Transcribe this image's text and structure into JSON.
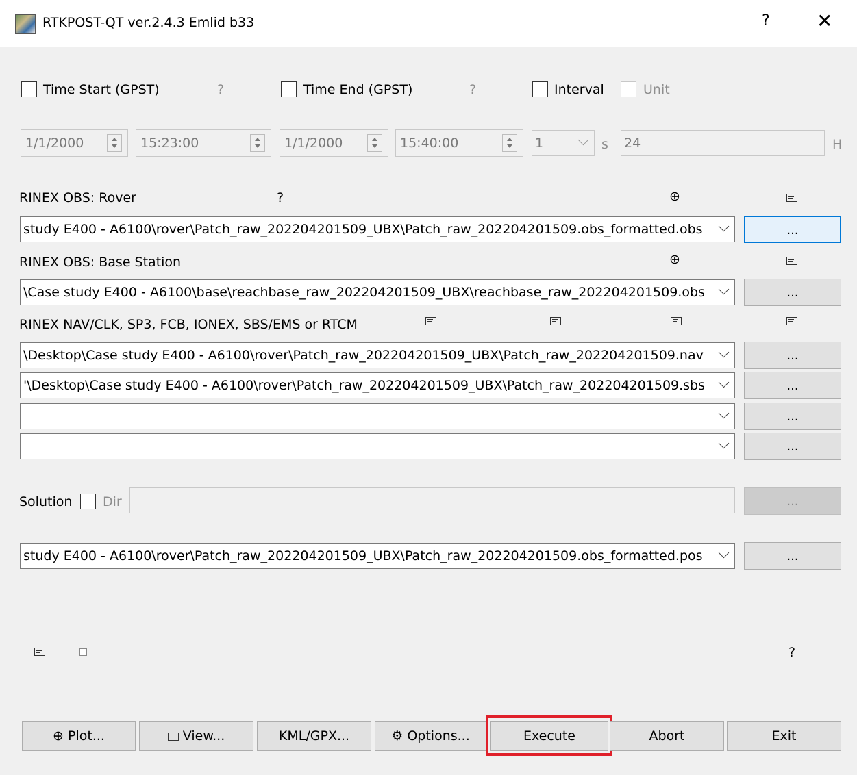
{
  "window": {
    "title": "RTKPOST-QT ver.2.4.3 Emlid b33",
    "help": "?",
    "close": "✕"
  },
  "time": {
    "start_label": "Time Start (GPST)",
    "start_help": "?",
    "end_label": "Time End (GPST)",
    "end_help": "?",
    "interval_label": "Interval",
    "unit_label": "Unit",
    "start_date": "1/1/2000",
    "start_time": "15:23:00",
    "end_date": "1/1/2000",
    "end_time": "15:40:00",
    "interval_value": "1",
    "interval_unit": "s",
    "unit_value": "24",
    "unit_suffix": "H"
  },
  "rover": {
    "label": "RINEX OBS: Rover",
    "help": "?",
    "path": "study E400 - A6100\\rover\\Patch_raw_202204201509_UBX\\Patch_raw_202204201509.obs_formatted.obs",
    "browse": "..."
  },
  "base": {
    "label": "RINEX OBS: Base Station",
    "path": "\\Case study E400 - A6100\\base\\reachbase_raw_202204201509_UBX\\reachbase_raw_202204201509.obs",
    "browse": "..."
  },
  "nav": {
    "label": "RINEX NAV/CLK, SP3, FCB, IONEX, SBS/EMS  or RTCM",
    "files": [
      "\\Desktop\\Case study E400 - A6100\\rover\\Patch_raw_202204201509_UBX\\Patch_raw_202204201509.nav",
      "'\\Desktop\\Case study E400 - A6100\\rover\\Patch_raw_202204201509_UBX\\Patch_raw_202204201509.sbs",
      "",
      ""
    ],
    "browse": "..."
  },
  "solution": {
    "label": "Solution",
    "dir_label": "Dir",
    "dir_value": "",
    "output_path": "study E400 - A6100\\rover\\Patch_raw_202204201509_UBX\\Patch_raw_202204201509.obs_formatted.pos",
    "browse": "...",
    "status_help": "?"
  },
  "buttons": {
    "plot": "Plot...",
    "view": "View...",
    "kml": "KML/GPX...",
    "options": "Options...",
    "execute": "Execute",
    "abort": "Abort",
    "exit": "Exit"
  },
  "colors": {
    "highlight": "#e0202a",
    "focus": "#0078d7"
  },
  "icons": {
    "plot": "⊕",
    "options": "⚙"
  }
}
